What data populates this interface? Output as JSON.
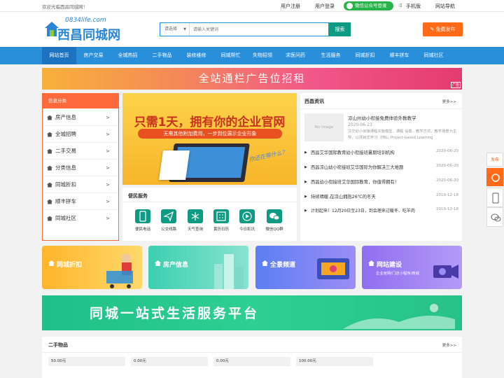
{
  "topbar": {
    "welcome": "欢迎光临西昌同城网！",
    "register": "用户注册",
    "login": "用户登录",
    "wechat_login": "微信公众号登录",
    "mobile": "手机版",
    "site_nav": "网站导航"
  },
  "logo": {
    "domain": "0834life.com",
    "name": "西昌同城网"
  },
  "search": {
    "select_label": "请选择",
    "placeholder": "请输入关键词",
    "button": "搜索"
  },
  "publish_button": "免费发布",
  "nav": [
    "网站首页",
    "房产交易",
    "全城热招",
    "二手物品",
    "装修维修",
    "同城帮忙",
    "失物招领",
    "求医问药",
    "生活服务",
    "同城折扣",
    "顺丰拼车",
    "同城社区"
  ],
  "banner_top": {
    "text": "全站通栏广告位招租",
    "tag": "广告"
  },
  "sidebar": {
    "title": "信息分类",
    "items": [
      "房产信息",
      "全城招聘",
      "二手交易",
      "分类信息",
      "同城折扣",
      "顺丰拼车",
      "同城社区"
    ],
    "arrow": ">"
  },
  "ad": {
    "headline": "只需1天，拥有你的企业官网",
    "sub": "无需其他附加费用，一步到位展示企业形象",
    "slogan": "你还在等什么？"
  },
  "services": {
    "title": "便民服务",
    "items": [
      "便民电话",
      "公交线路",
      "天气查询",
      "黄历日历",
      "今日影讯",
      "微信QQ群"
    ]
  },
  "news": {
    "title": "西昌资讯",
    "more": "更多>>",
    "headline": {
      "title": "凉山州幼小衔接免费体验外教教学",
      "date": "2020-06-23",
      "desc": "艾华幼小衔接课程实施模型、课程 设置、教学方式、教学场景为主导，以项目式学习（PBL, Project-based Learning",
      "img": "No Image"
    },
    "items": [
      {
        "title": "西昌艾华国际教育幼小衔接班暑期培训机构",
        "date": "2020-06-20"
      },
      {
        "title": "西昌凉山幼小衔接班艾华国际为你解决三大难题",
        "date": "2020-06-20"
      },
      {
        "title": "西昌幼小衔接班艾华国际教育，你值得拥有！",
        "date": "2020-06-20"
      },
      {
        "title": "持续晴暖,在凉山拥抱26℃的冬天",
        "date": "2019-12-18"
      },
      {
        "title": "计划起来！12月20日至23日，到会理来过暖冬、吃羊肉",
        "date": "2019-12-18"
      }
    ]
  },
  "tiles": [
    {
      "label": "同城折扣",
      "sub": "",
      "color1": "#ffb52b",
      "color2": "#ffd86a"
    },
    {
      "label": "房产信息",
      "sub": "",
      "color1": "#3ccfb0",
      "color2": "#88e3cf"
    },
    {
      "label": "全景频道",
      "sub": "",
      "color1": "#5b7ff2",
      "color2": "#9d8cf7"
    },
    {
      "label": "网站建设",
      "sub": "企业官网/门店小程序/商城",
      "color1": "#8f6ef0",
      "color2": "#b49bf7"
    }
  ],
  "banner_bottom": {
    "text": "同城一站式生活服务平台"
  },
  "secondhand": {
    "title": "二手物品",
    "more": "更多>>",
    "prices": [
      "50.00元",
      "0.00元",
      "0.00元",
      "100.00元"
    ]
  },
  "float": {
    "publish": "发布"
  },
  "colors": {
    "brand_blue": "#2a8fdb",
    "orange": "#ff6a18",
    "green": "#0f9a84",
    "wechat": "#28b34a"
  }
}
